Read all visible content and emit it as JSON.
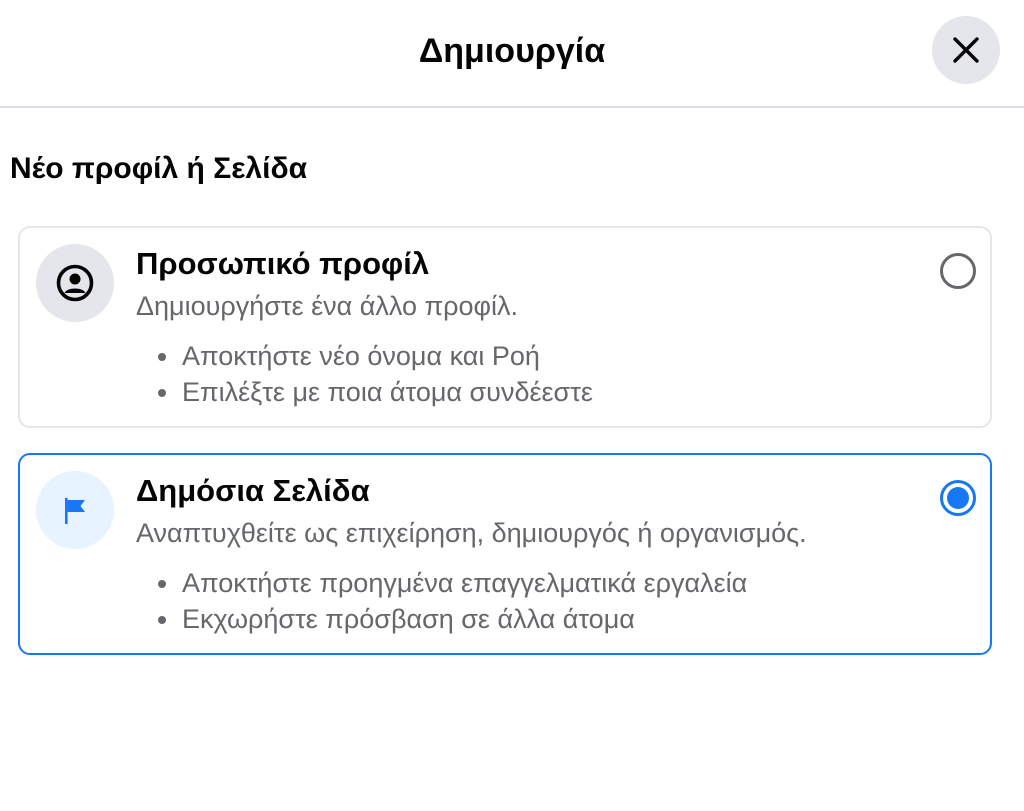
{
  "header": {
    "title": "Δημιουργία",
    "close_icon": "close-icon"
  },
  "section": {
    "title": "Νέο προφίλ ή Σελίδα"
  },
  "options": [
    {
      "icon": "user-circle-icon",
      "title": "Προσωπικό προφίλ",
      "description": "Δημιουργήστε ένα άλλο προφίλ.",
      "bullets": [
        "Αποκτήστε νέο όνομα και Ροή",
        "Επιλέξτε με ποια άτομα συνδέεστε"
      ],
      "selected": false
    },
    {
      "icon": "flag-icon",
      "title": "Δημόσια Σελίδα",
      "description": "Αναπτυχθείτε ως επιχείρηση, δημιουργός ή οργανισμός.",
      "bullets": [
        "Αποκτήστε προηγμένα επαγγελματικά εργαλεία",
        "Εκχωρήστε πρόσβαση σε άλλα άτομα"
      ],
      "selected": true
    }
  ],
  "colors": {
    "accent": "#1877f2",
    "secondary_text": "#65676b",
    "icon_bg_grey": "#e4e6eb",
    "icon_bg_blue": "#e7f3ff"
  }
}
